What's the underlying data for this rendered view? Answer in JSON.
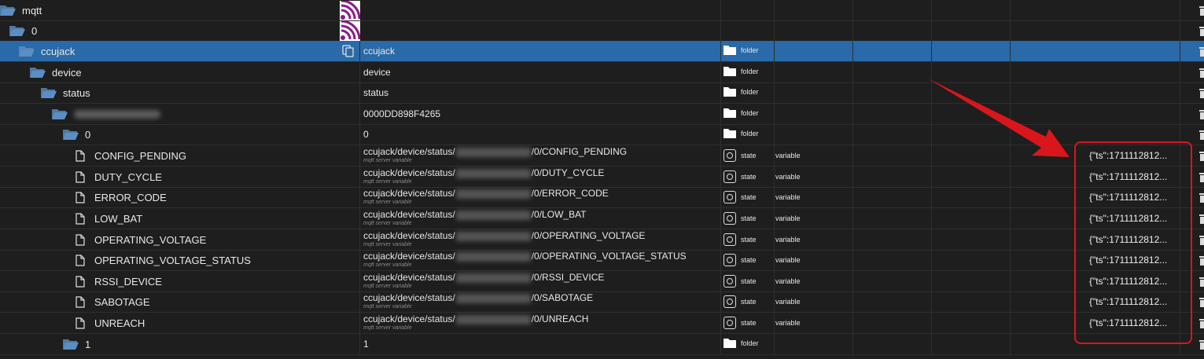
{
  "tree": {
    "rows": [
      {
        "name": "mqtt",
        "kind": "folder",
        "icon": "folder-open-icon",
        "id_text": "",
        "type_label": "",
        "role": "",
        "value": "",
        "extra_icon": "wifi-icon"
      },
      {
        "name": "0",
        "kind": "folder",
        "icon": "folder-open-icon",
        "id_text": "",
        "type_label": "",
        "role": "",
        "value": "",
        "extra_icon": "wifi-icon"
      },
      {
        "name": "ccujack",
        "kind": "folder",
        "icon": "folder-open-icon",
        "id_text": "ccujack",
        "type_label": "folder",
        "role": "",
        "value": "",
        "selected": true,
        "extra_icon": "copy-icon"
      },
      {
        "name": "device",
        "kind": "folder",
        "icon": "folder-open-icon",
        "id_text": "device",
        "type_label": "folder",
        "role": "",
        "value": ""
      },
      {
        "name": "status",
        "kind": "folder",
        "icon": "folder-open-icon",
        "id_text": "status",
        "type_label": "folder",
        "role": "",
        "value": ""
      },
      {
        "name": "",
        "name_blurred": true,
        "kind": "folder",
        "icon": "folder-open-icon",
        "id_text": "0000DD898F4265",
        "type_label": "folder",
        "role": "",
        "value": ""
      },
      {
        "name": "0",
        "kind": "folder",
        "icon": "folder-open-icon",
        "id_text": "0",
        "type_label": "folder",
        "role": "",
        "value": ""
      },
      {
        "name": "CONFIG_PENDING",
        "kind": "state",
        "icon": "file-icon",
        "id_prefix": "ccujack/device/status/",
        "id_suffix": "/0/CONFIG_PENDING",
        "id_sub": "mqtt server variable",
        "type_label": "state",
        "role": "variable",
        "value": "{\"ts\":1711112812..."
      },
      {
        "name": "DUTY_CYCLE",
        "kind": "state",
        "icon": "file-icon",
        "id_prefix": "ccujack/device/status/",
        "id_suffix": "/0/DUTY_CYCLE",
        "id_sub": "mqtt server variable",
        "type_label": "state",
        "role": "variable",
        "value": "{\"ts\":1711112812..."
      },
      {
        "name": "ERROR_CODE",
        "kind": "state",
        "icon": "file-icon",
        "id_prefix": "ccujack/device/status/",
        "id_suffix": "/0/ERROR_CODE",
        "id_sub": "mqtt server variable",
        "type_label": "state",
        "role": "variable",
        "value": "{\"ts\":1711112812..."
      },
      {
        "name": "LOW_BAT",
        "kind": "state",
        "icon": "file-icon",
        "id_prefix": "ccujack/device/status/",
        "id_suffix": "/0/LOW_BAT",
        "id_sub": "mqtt server variable",
        "type_label": "state",
        "role": "variable",
        "value": "{\"ts\":1711112812..."
      },
      {
        "name": "OPERATING_VOLTAGE",
        "kind": "state",
        "icon": "file-icon",
        "id_prefix": "ccujack/device/status/",
        "id_suffix": "/0/OPERATING_VOLTAGE",
        "id_sub": "mqtt server variable",
        "type_label": "state",
        "role": "variable",
        "value": "{\"ts\":1711112812..."
      },
      {
        "name": "OPERATING_VOLTAGE_STATUS",
        "kind": "state",
        "icon": "file-icon",
        "id_prefix": "ccujack/device/status/",
        "id_suffix": "/0/OPERATING_VOLTAGE_STATUS",
        "id_sub": "mqtt server variable",
        "type_label": "state",
        "role": "variable",
        "value": "{\"ts\":1711112812..."
      },
      {
        "name": "RSSI_DEVICE",
        "kind": "state",
        "icon": "file-icon",
        "id_prefix": "ccujack/device/status/",
        "id_suffix": "/0/RSSI_DEVICE",
        "id_sub": "mqtt server variable",
        "type_label": "state",
        "role": "variable",
        "value": "{\"ts\":1711112812..."
      },
      {
        "name": "SABOTAGE",
        "kind": "state",
        "icon": "file-icon",
        "id_prefix": "ccujack/device/status/",
        "id_suffix": "/0/SABOTAGE",
        "id_sub": "mqtt server variable",
        "type_label": "state",
        "role": "variable",
        "value": "{\"ts\":1711112812..."
      },
      {
        "name": "UNREACH",
        "kind": "state",
        "icon": "file-icon",
        "id_prefix": "ccujack/device/status/",
        "id_suffix": "/0/UNREACH",
        "id_sub": "mqtt server variable",
        "type_label": "state",
        "role": "variable",
        "value": "{\"ts\":1711112812..."
      },
      {
        "name": "1",
        "kind": "folder",
        "icon": "folder-open-icon",
        "id_text": "1",
        "type_label": "folder",
        "role": "",
        "value": ""
      }
    ]
  },
  "colors": {
    "background": "#1e1e1e",
    "selected_row": "#2a6aa8",
    "folder_icon": "#5b8ec4",
    "wifi_icon": "#8b1a8b",
    "annotation": "#d9161c"
  }
}
